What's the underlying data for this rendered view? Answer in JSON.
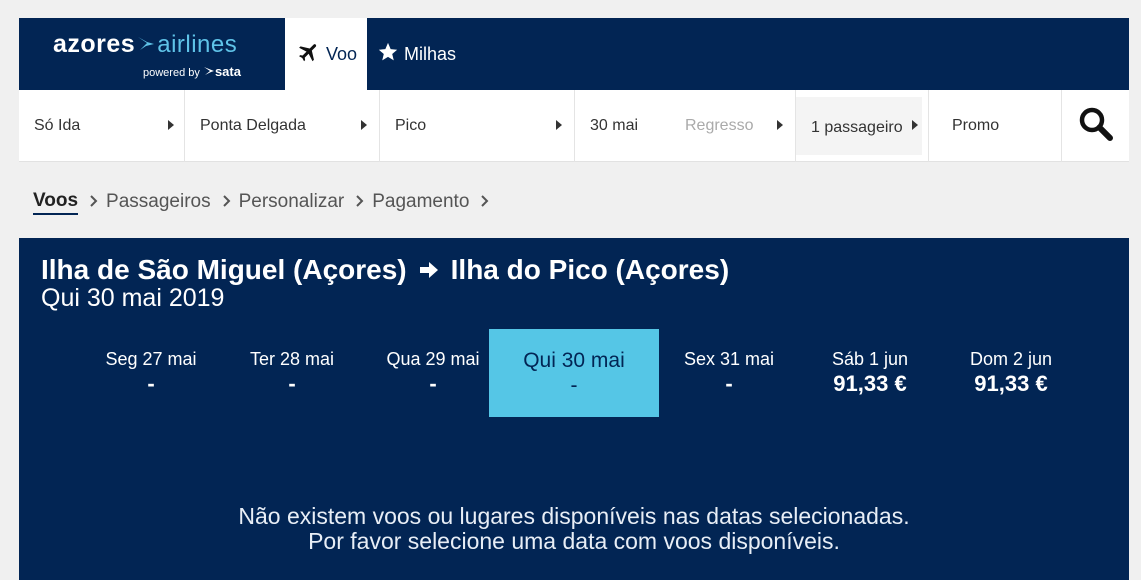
{
  "brand": {
    "logo_text_1": "azores",
    "logo_text_2": "airlines",
    "powered": "powered by",
    "parent": "sata"
  },
  "tabs": [
    {
      "label": "Voo",
      "icon": "plane-icon",
      "active": true
    },
    {
      "label": "Milhas",
      "icon": "star-icon",
      "active": false
    }
  ],
  "search": {
    "trip_type": "Só Ida",
    "origin": "Ponta Delgada",
    "destination": "Pico",
    "depart_date": "30 mai",
    "return_placeholder": "Regresso",
    "passengers": "1 passageiro",
    "promo": "Promo",
    "search_icon": "search-icon"
  },
  "breadcrumb": [
    "Voos",
    "Passageiros",
    "Personalizar",
    "Pagamento"
  ],
  "flight": {
    "origin": "Ilha de São Miguel (Açores)",
    "destination": "Ilha do Pico (Açores)",
    "date": "Qui 30 mai 2019"
  },
  "days": [
    {
      "label": "Seg 27 mai",
      "price": "-"
    },
    {
      "label": "Ter 28 mai",
      "price": "-"
    },
    {
      "label": "Qua 29 mai",
      "price": "-"
    },
    {
      "label": "Qui 30 mai",
      "price": "-",
      "selected": true
    },
    {
      "label": "Sex 31 mai",
      "price": "-"
    },
    {
      "label": "Sáb 1 jun",
      "price": "91,33 €"
    },
    {
      "label": "Dom 2 jun",
      "price": "91,33 €"
    }
  ],
  "message": {
    "line1": "Não existem voos ou lugares disponíveis nas datas selecionadas.",
    "line2": "Por favor selecione uma data com voos disponíveis."
  },
  "colors": {
    "navy": "#022554",
    "accent": "#55c6e6"
  }
}
